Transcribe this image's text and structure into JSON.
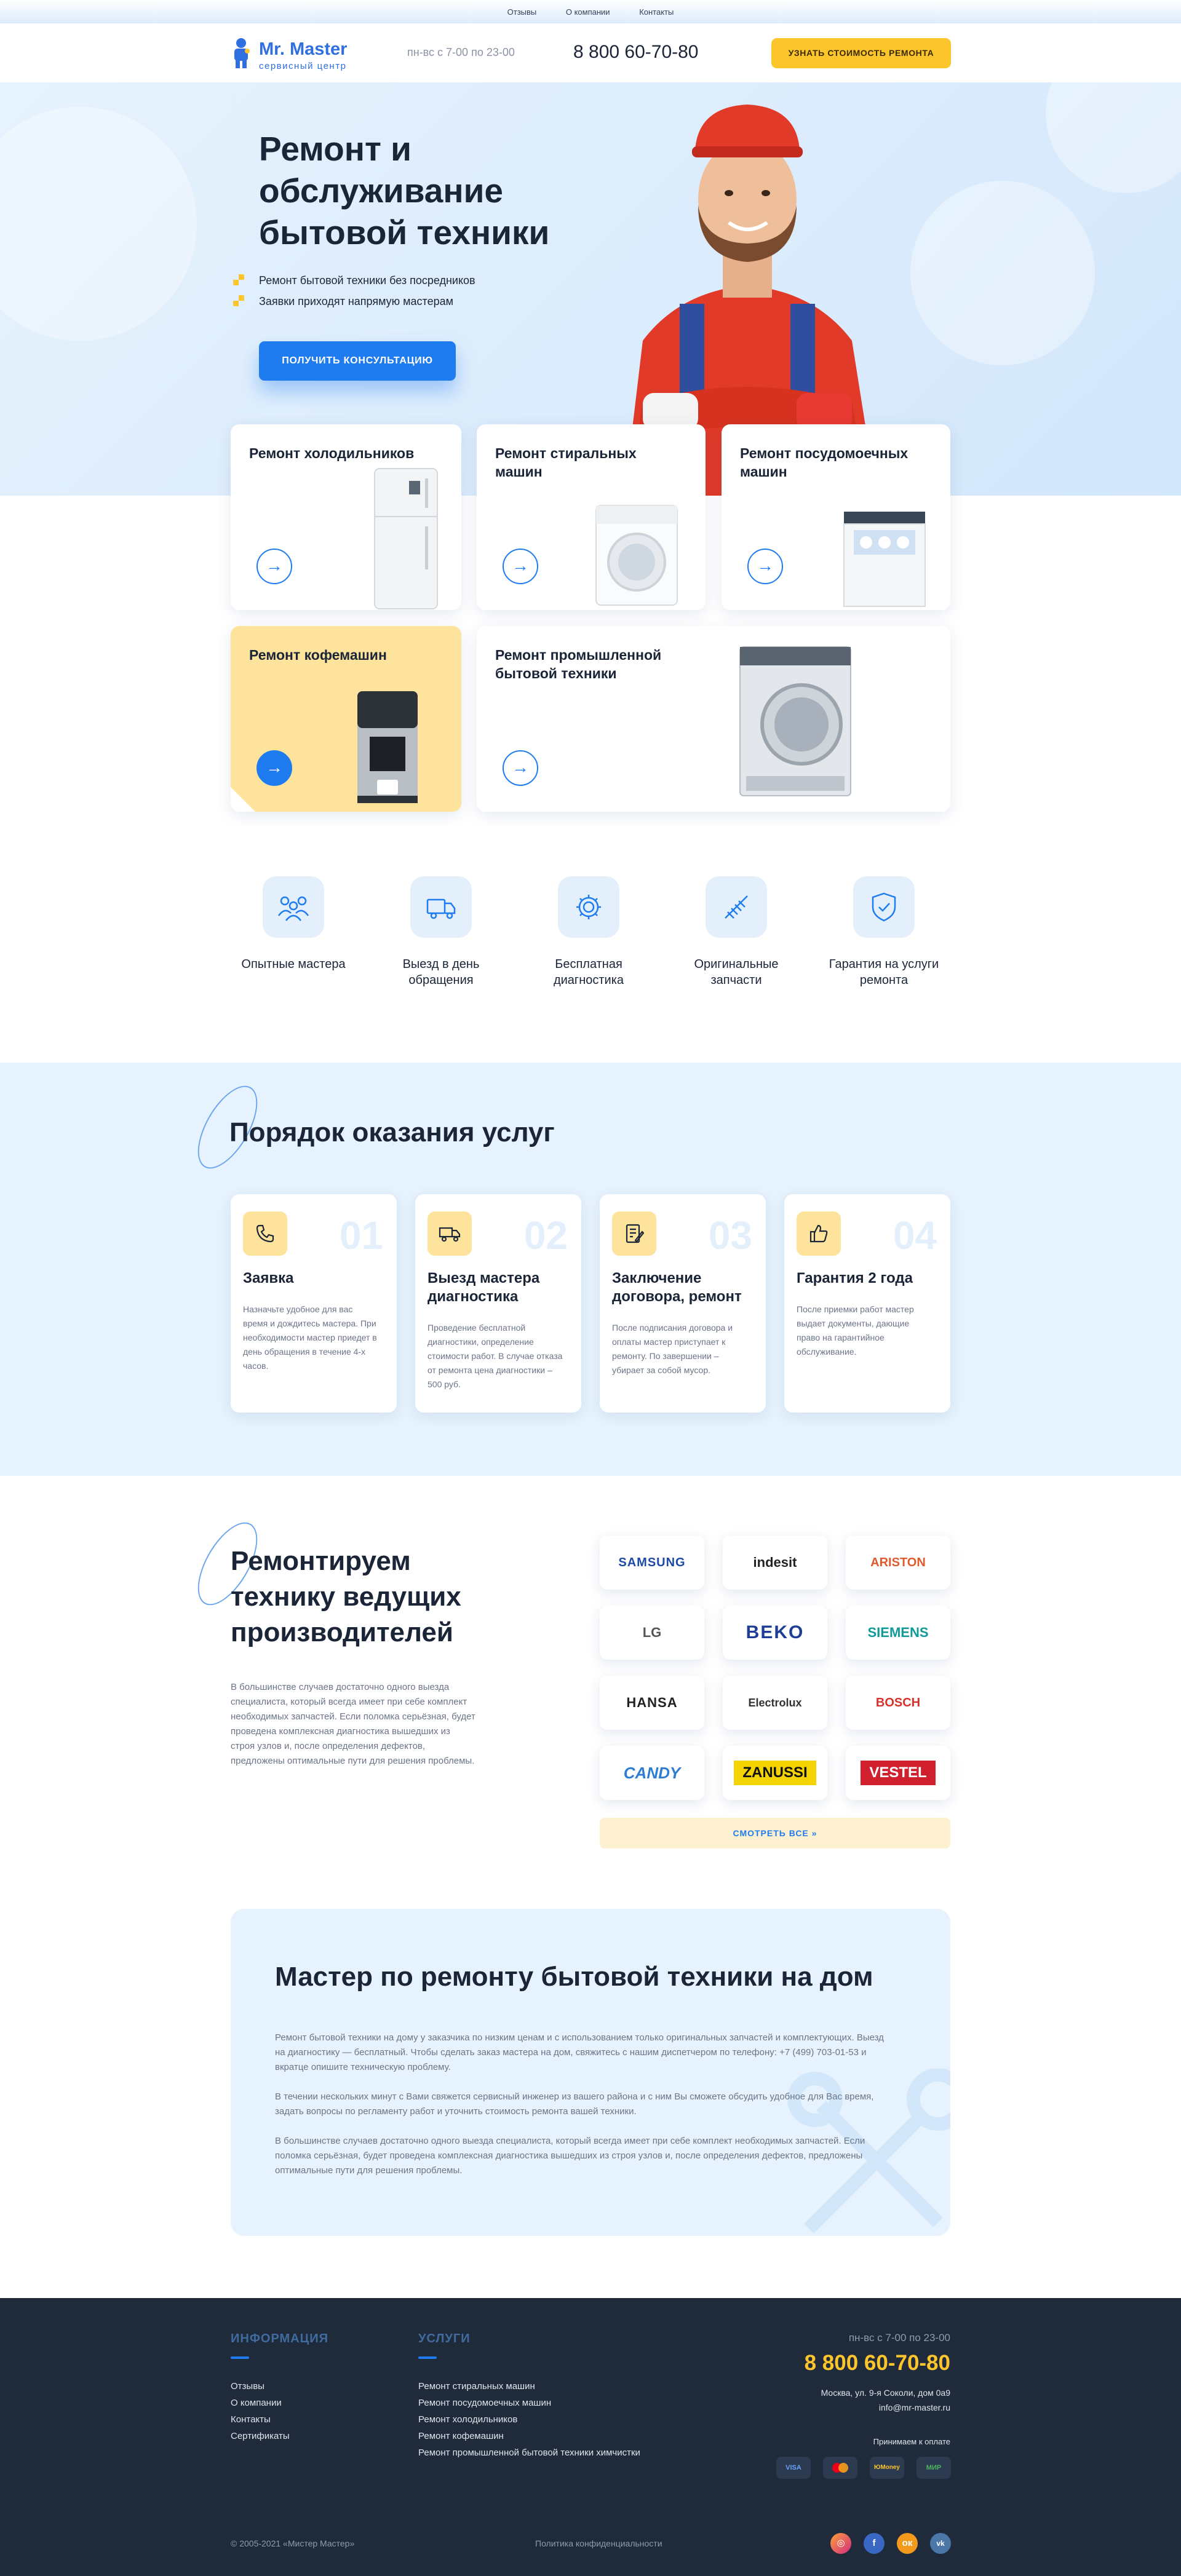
{
  "topnav": [
    "Отзывы",
    "О компании",
    "Контакты"
  ],
  "header": {
    "logo_title": "Mr. Master",
    "logo_subtitle": "сервисный центр",
    "hours": "пн-вс с 7-00 по 23-00",
    "phone": "8 800 60-70-80",
    "cta": "УЗНАТЬ СТОИМОСТЬ РЕМОНТА"
  },
  "hero": {
    "title": "Ремонт и обслуживание бытовой техники",
    "bullets": [
      "Ремонт бытовой техники без посредников",
      "Заявки приходят напрямую мастерам"
    ],
    "cta": "ПОЛУЧИТЬ КОНСУЛЬТАЦИЮ"
  },
  "services": [
    {
      "title": "Ремонт холодильников"
    },
    {
      "title": "Ремонт стиральных машин"
    },
    {
      "title": "Ремонт посудомоечных машин"
    },
    {
      "title": "Ремонт кофемашин"
    },
    {
      "title": "Ремонт промышленной бытовой техники"
    }
  ],
  "features": [
    {
      "label": "Опытные мастера",
      "icon": "people-icon"
    },
    {
      "label": "Выезд в день обращения",
      "icon": "truck-icon"
    },
    {
      "label": "Бесплатная диагностика",
      "icon": "gear-icon"
    },
    {
      "label": "Оригинальные запчасти",
      "icon": "spring-icon"
    },
    {
      "label": "Гарантия на услуги ремонта",
      "icon": "shield-icon"
    }
  ],
  "process": {
    "title": "Порядок оказания услуг",
    "steps": [
      {
        "num": "01",
        "title": "Заявка",
        "text": "Назначьте удобное для вас время и дождитесь мастера. При необходимости мастер приедет в день обращения в течение 4-х часов."
      },
      {
        "num": "02",
        "title": "Выезд мастера диагностика",
        "text": "Проведение бесплатной диагностики, определение стоимости работ. В случае отказа от ремонта цена диагностики – 500 руб."
      },
      {
        "num": "03",
        "title": "Заключение договора, ремонт",
        "text": "После подписания договора и оплаты мастер приступает к ремонту. По завершении – убирает за собой мусор."
      },
      {
        "num": "04",
        "title": "Гарантия 2 года",
        "text": "После приемки работ мастер выдает документы, дающие право на гарантийное обслуживание."
      }
    ]
  },
  "brands": {
    "title": "Ремонтируем технику ведущих производителей",
    "text": "В большинстве случаев достаточно одного выезда специалиста, который всегда имеет при себе комплект необходимых запчастей. Если поломка серьёзная, будет проведена комплексная диагностика вышедших из строя узлов и, после определения дефектов, предложены оптимальные пути для решения проблемы.",
    "logos": [
      "SAMSUNG",
      "indesit",
      "ARISTON",
      "LG",
      "BEKO",
      "SIEMENS",
      "HANSA",
      "Electrolux",
      "BOSCH",
      "CANDY",
      "ZANUSSI",
      "VESTEL"
    ],
    "see_all": "СМОТРЕТЬ ВСЕ »"
  },
  "master": {
    "title": "Мастер по ремонту бытовой техники на дом",
    "paragraphs": [
      "Ремонт бытовой техники на дому у заказчика по низким ценам и с использованием только оригинальных запчастей и комплектующих. Выезд на диагностику — бесплатный. Чтобы сделать заказ мастера на дом, свяжитесь с нашим диспетчером по телефону: +7 (499) 703-01-53 и вкратце опишите техническую проблему.",
      "В течении нескольких минут с Вами свяжется сервисный инженер из вашего района и с ним Вы сможете обсудить удобное для Вас время, задать вопросы по регламенту работ и уточнить стоимость ремонта вашей техники.",
      "В большинстве случаев достаточно одного выезда специалиста, который всегда имеет при себе комплект необходимых запчастей. Если поломка серьёзная, будет проведена комплексная диагностика вышедших из строя узлов и, после определения дефектов, предложены оптимальные пути для решения проблемы."
    ]
  },
  "footer": {
    "info_title": "ИНФОРМАЦИЯ",
    "info_links": [
      "Отзывы",
      "О компании",
      "Контакты",
      "Сертификаты"
    ],
    "services_title": "УСЛУГИ",
    "service_links": [
      "Ремонт стиральных машин",
      "Ремонт посудомоечных машин",
      "Ремонт холодильников",
      "Ремонт кофемашин",
      "Ремонт промышленной бытовой техники химчистки"
    ],
    "hours": "пн-вс с 7-00 по 23-00",
    "phone": "8 800 60-70-80",
    "address": "Москва, ул. 9-я Соколи, дом 0а9",
    "email": "info@mr-master.ru",
    "pay_title": "Принимаем к оплате",
    "payments": [
      "VISA",
      "MC",
      "ЮMoney",
      "МИР"
    ],
    "copyright": "© 2005-2021 «Мистер Мастер»",
    "privacy": "Политика конфиденциальности",
    "socials": [
      "instagram-icon",
      "facebook-icon",
      "odnoklassniki-icon",
      "vk-icon"
    ],
    "accent": "#fdc52c"
  }
}
